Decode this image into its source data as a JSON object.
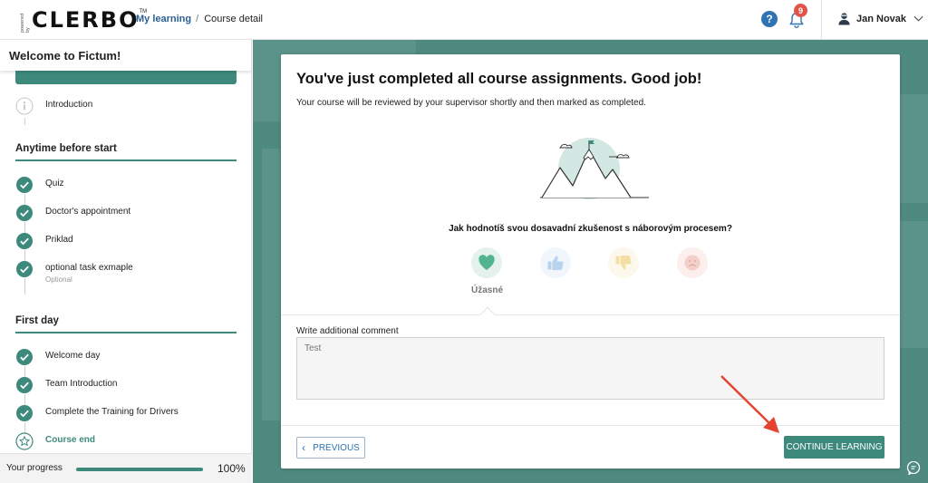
{
  "header": {
    "logo": "CLERBO",
    "logo_small": "powered by",
    "logo_tm": "TM",
    "breadcrumb": {
      "link": "My learning",
      "separator": "/",
      "current": "Course detail"
    },
    "help_icon_label": "?",
    "notifications_count": "9",
    "user_name": "Jan Novak"
  },
  "sidebar": {
    "title": "Welcome to Fictum!",
    "intro": {
      "label": "Introduction"
    },
    "sections": [
      {
        "title": "Anytime before start",
        "items": [
          {
            "label": "Quiz"
          },
          {
            "label": "Doctor's appointment"
          },
          {
            "label": "Priklad"
          },
          {
            "label": "optional task exmaple",
            "sub": "Optional"
          }
        ]
      },
      {
        "title": "First day",
        "items": [
          {
            "label": "Welcome day"
          },
          {
            "label": "Team Introduction"
          },
          {
            "label": "Complete the Training for Drivers"
          },
          {
            "label": "Course end"
          }
        ]
      }
    ],
    "progress": {
      "label": "Your progress",
      "value": "100%",
      "fraction": 1.0
    }
  },
  "card": {
    "title": "You've just completed all course assignments. Good job!",
    "subtitle": "Your course will be reviewed by your supervisor shortly and then marked as completed.",
    "question": "Jak hodnotíš svou dosavadní zkušenost s náborovým procesem?",
    "ratings": [
      {
        "icon": "heart-icon",
        "selected": true,
        "label": "Úžasné"
      },
      {
        "icon": "thumbs-up-icon",
        "selected": false
      },
      {
        "icon": "thumbs-down-icon",
        "selected": false
      },
      {
        "icon": "sad-face-icon",
        "selected": false
      }
    ],
    "comment": {
      "label": "Write additional comment",
      "placeholder": "Test"
    },
    "buttons": {
      "previous": "PREVIOUS",
      "continue": "CONTINUE LEARNING"
    }
  },
  "colors": {
    "accent": "#3d8a7d",
    "link": "#2b5f92",
    "badge": "#e2544a",
    "annotation_arrow": "#e5432f"
  }
}
